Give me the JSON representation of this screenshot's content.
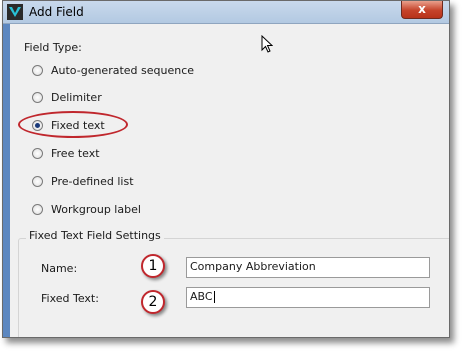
{
  "window": {
    "title": "Add Field",
    "close_label": "x"
  },
  "field_type": {
    "label": "Field Type:",
    "options": [
      {
        "label": "Auto-generated sequence",
        "selected": false
      },
      {
        "label": "Delimiter",
        "selected": false
      },
      {
        "label": "Fixed text",
        "selected": true
      },
      {
        "label": "Free text",
        "selected": false
      },
      {
        "label": "Pre-defined list",
        "selected": false
      },
      {
        "label": "Workgroup label",
        "selected": false
      }
    ]
  },
  "settings": {
    "title": "Fixed Text Field Settings",
    "name_label": "Name:",
    "name_value": "Company Abbreviation",
    "fixed_text_label": "Fixed Text:",
    "fixed_text_value": "ABC"
  },
  "callouts": [
    "1",
    "2"
  ],
  "colors": {
    "accent": "#c0272d",
    "title_bar": "#b3c9e2",
    "left_strip": "#5c87c0"
  }
}
